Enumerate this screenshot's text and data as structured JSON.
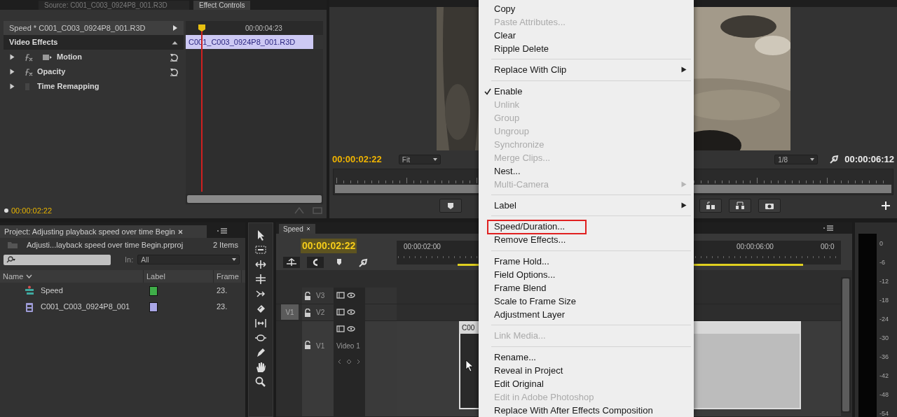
{
  "effect_controls": {
    "tabs": [
      {
        "label": "Source: C001_C003_0924P8_001.R3D",
        "selected": false
      },
      {
        "label": "Effect Controls",
        "selected": true
      }
    ],
    "clip_header": "Speed * C001_C003_0924P8_001.R3D",
    "ruler_time": "00:00:04:23",
    "clip_bar": "C001_C003_0924P8_001.R3D",
    "section": "Video Effects",
    "effects": [
      {
        "name": "Motion",
        "kind": "transform",
        "resettable": true
      },
      {
        "name": "Opacity",
        "kind": "fx",
        "resettable": true
      },
      {
        "name": "Time Remapping",
        "kind": "plain",
        "resettable": false
      }
    ],
    "timecode": "00:00:02:22"
  },
  "program_monitor": {
    "timecode": "00:00:02:22",
    "zoom": "Fit",
    "resolution": "1/8",
    "duration": "00:00:06:12"
  },
  "project_panel": {
    "tab": "Project: Adjusting playback speed over time Begin",
    "file": "Adjusti...layback speed over time Begin.prproj",
    "item_count": "2 Items",
    "filter_label": "In:",
    "filter_value": "All",
    "columns": [
      "Name",
      "Label",
      "Frame"
    ],
    "items": [
      {
        "name": "Speed",
        "kind": "sequence",
        "color": "#3fae49",
        "frame_rate": "23."
      },
      {
        "name": "C001_C003_0924P8_001",
        "kind": "clip",
        "color": "#a9a6e6",
        "frame_rate": "23."
      }
    ]
  },
  "timeline": {
    "tab": "Speed",
    "timecode": "00:00:02:22",
    "ruler_labels": [
      "00:00:02:00",
      "00:00:06:00",
      "00:0"
    ],
    "source_patch": "V1",
    "tracks": [
      {
        "name": "V3"
      },
      {
        "name": "V2"
      },
      {
        "name": "V1",
        "label": "Video 1"
      }
    ],
    "clip_name": "C00"
  },
  "context_menu": {
    "items": [
      {
        "kind": "item",
        "label": "Copy",
        "disabled": false,
        "checked": false,
        "submenu": false,
        "outlined": false
      },
      {
        "kind": "item",
        "label": "Paste Attributes...",
        "disabled": true,
        "checked": false,
        "submenu": false,
        "outlined": false
      },
      {
        "kind": "item",
        "label": "Clear",
        "disabled": false,
        "checked": false,
        "submenu": false,
        "outlined": false
      },
      {
        "kind": "item",
        "label": "Ripple Delete",
        "disabled": false,
        "checked": false,
        "submenu": false,
        "outlined": false
      },
      {
        "kind": "separator"
      },
      {
        "kind": "item",
        "label": "Replace With Clip",
        "disabled": false,
        "checked": false,
        "submenu": true,
        "outlined": false
      },
      {
        "kind": "separator"
      },
      {
        "kind": "item",
        "label": "Enable",
        "disabled": false,
        "checked": true,
        "submenu": false,
        "outlined": false
      },
      {
        "kind": "item",
        "label": "Unlink",
        "disabled": true,
        "checked": false,
        "submenu": false,
        "outlined": false
      },
      {
        "kind": "item",
        "label": "Group",
        "disabled": true,
        "checked": false,
        "submenu": false,
        "outlined": false
      },
      {
        "kind": "item",
        "label": "Ungroup",
        "disabled": true,
        "checked": false,
        "submenu": false,
        "outlined": false
      },
      {
        "kind": "item",
        "label": "Synchronize",
        "disabled": true,
        "checked": false,
        "submenu": false,
        "outlined": false
      },
      {
        "kind": "item",
        "label": "Merge Clips...",
        "disabled": true,
        "checked": false,
        "submenu": false,
        "outlined": false
      },
      {
        "kind": "item",
        "label": "Nest...",
        "disabled": false,
        "checked": false,
        "submenu": false,
        "outlined": false
      },
      {
        "kind": "item",
        "label": "Multi-Camera",
        "disabled": true,
        "checked": false,
        "submenu": true,
        "outlined": false
      },
      {
        "kind": "separator"
      },
      {
        "kind": "item",
        "label": "Label",
        "disabled": false,
        "checked": false,
        "submenu": true,
        "outlined": false
      },
      {
        "kind": "separator"
      },
      {
        "kind": "item",
        "label": "Speed/Duration...",
        "disabled": false,
        "checked": false,
        "submenu": false,
        "outlined": true
      },
      {
        "kind": "item",
        "label": "Remove Effects...",
        "disabled": false,
        "checked": false,
        "submenu": false,
        "outlined": false
      },
      {
        "kind": "separator"
      },
      {
        "kind": "item",
        "label": "Frame Hold...",
        "disabled": false,
        "checked": false,
        "submenu": false,
        "outlined": false
      },
      {
        "kind": "item",
        "label": "Field Options...",
        "disabled": false,
        "checked": false,
        "submenu": false,
        "outlined": false
      },
      {
        "kind": "item",
        "label": "Frame Blend",
        "disabled": false,
        "checked": false,
        "submenu": false,
        "outlined": false
      },
      {
        "kind": "item",
        "label": "Scale to Frame Size",
        "disabled": false,
        "checked": false,
        "submenu": false,
        "outlined": false
      },
      {
        "kind": "item",
        "label": "Adjustment Layer",
        "disabled": false,
        "checked": false,
        "submenu": false,
        "outlined": false
      },
      {
        "kind": "separator"
      },
      {
        "kind": "item",
        "label": "Link Media...",
        "disabled": true,
        "checked": false,
        "submenu": false,
        "outlined": false
      },
      {
        "kind": "separator"
      },
      {
        "kind": "item",
        "label": "Rename...",
        "disabled": false,
        "checked": false,
        "submenu": false,
        "outlined": false
      },
      {
        "kind": "item",
        "label": "Reveal in Project",
        "disabled": false,
        "checked": false,
        "submenu": false,
        "outlined": false
      },
      {
        "kind": "item",
        "label": "Edit Original",
        "disabled": false,
        "checked": false,
        "submenu": false,
        "outlined": false
      },
      {
        "kind": "item",
        "label": "Edit in Adobe Photoshop",
        "disabled": true,
        "checked": false,
        "submenu": false,
        "outlined": false
      },
      {
        "kind": "item",
        "label": "Replace With After Effects Composition",
        "disabled": false,
        "checked": false,
        "submenu": false,
        "outlined": false
      }
    ]
  },
  "audio_meter": {
    "scale": [
      "0",
      "-6",
      "-12",
      "-18",
      "-24",
      "-30",
      "-36",
      "-42",
      "-48",
      "-54"
    ]
  }
}
